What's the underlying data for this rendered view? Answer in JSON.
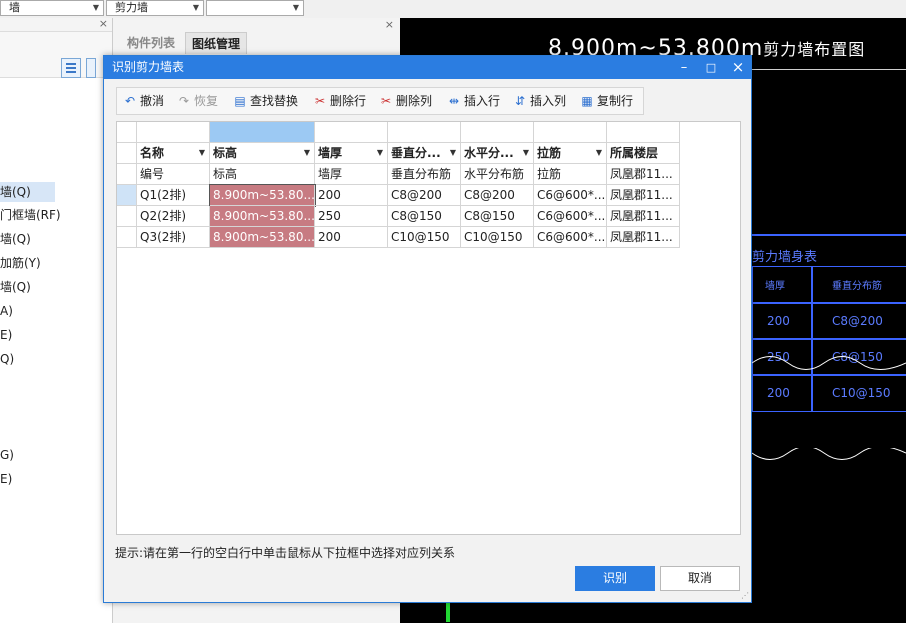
{
  "topbar": {
    "combo1": "墙",
    "combo2": "剪力墙",
    "combo3": ""
  },
  "left_panel": {
    "items": [
      "墙(Q)",
      "门框墙(RF)",
      "墙(Q)",
      "加筋(Y)",
      "墙(Q)",
      "A)",
      "E)",
      "Q)",
      "G)",
      "E)"
    ]
  },
  "mid_panel": {
    "tabs": [
      "构件列表",
      "图纸管理"
    ]
  },
  "cad": {
    "title": "8.900m~53.800m",
    "title_suffix": "剪力墙布置图",
    "table_title": "剪力墙身表",
    "col_wall_thickness": "墙厚",
    "col_vertical": "垂直分布筋",
    "rows": [
      {
        "thickness": "200",
        "vertical": "C8@200"
      },
      {
        "thickness": "250",
        "vertical": "C8@150"
      },
      {
        "thickness": "200",
        "vertical": "C10@150"
      }
    ]
  },
  "dialog": {
    "title": "识别剪力墙表",
    "controls": {
      "minimize": "–",
      "maximize": "□",
      "close": "×"
    },
    "toolbar": [
      {
        "label": "撤消",
        "icon": "undo-icon",
        "glyph": "↶",
        "enabled": true
      },
      {
        "label": "恢复",
        "icon": "redo-icon",
        "glyph": "↷",
        "enabled": false
      },
      {
        "label": "查找替换",
        "icon": "find-replace-icon",
        "glyph": "▤",
        "enabled": true
      },
      {
        "label": "删除行",
        "icon": "delete-row-icon",
        "glyph": "✂",
        "enabled": true
      },
      {
        "label": "删除列",
        "icon": "delete-column-icon",
        "glyph": "✂",
        "enabled": true
      },
      {
        "label": "插入行",
        "icon": "insert-row-icon",
        "glyph": "⇹",
        "enabled": true
      },
      {
        "label": "插入列",
        "icon": "insert-column-icon",
        "glyph": "⇵",
        "enabled": true
      },
      {
        "label": "复制行",
        "icon": "copy-row-icon",
        "glyph": "▦",
        "enabled": true
      }
    ],
    "grid": {
      "headers": [
        "名称",
        "标高",
        "墙厚",
        "垂直分...",
        "水平分...",
        "拉筋",
        "所属楼层"
      ],
      "subheaders": [
        "编号",
        "标高",
        "墙厚",
        "垂直分布筋",
        "水平分布筋",
        "拉筋",
        "凤凰郡11..."
      ],
      "rows": [
        [
          "Q1(2排)",
          "8.900m~53.80...",
          "200",
          "C8@200",
          "C8@200",
          "C6@600*...",
          "凤凰郡11..."
        ],
        [
          "Q2(2排)",
          "8.900m~53.80...",
          "250",
          "C8@150",
          "C8@150",
          "C6@600*...",
          "凤凰郡11..."
        ],
        [
          "Q3(2排)",
          "8.900m~53.80...",
          "200",
          "C10@150",
          "C10@150",
          "C6@600*...",
          "凤凰郡11..."
        ]
      ]
    },
    "hint": "提示:请在第一行的空白行中单击鼠标从下拉框中选择对应列关系",
    "ok_label": "识别",
    "cancel_label": "取消"
  }
}
